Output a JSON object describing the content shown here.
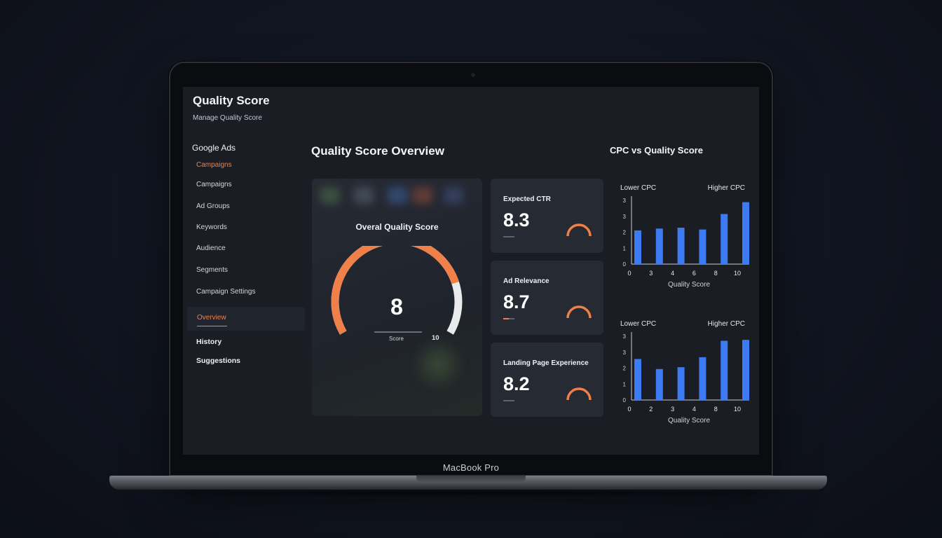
{
  "device": {
    "label": "MacBook Pro"
  },
  "app": {
    "title": "Quality Score",
    "subtitle": "Manage Quality Score"
  },
  "sidebar": {
    "section": "Google Ads",
    "items": [
      {
        "label": "Campaigns",
        "state": "active"
      },
      {
        "label": "Campaigns"
      },
      {
        "label": "Ad Groups"
      },
      {
        "label": "Keywords"
      },
      {
        "label": "Audience"
      },
      {
        "label": "Segments"
      },
      {
        "label": "Campaign Settings"
      }
    ],
    "overview": "Overview",
    "history": "History",
    "suggestions": "Suggestions"
  },
  "overview": {
    "title": "Quality Score Overview",
    "gauge": {
      "label": "Overal Quality Score",
      "value": "8",
      "score_label": "Score",
      "max": "10",
      "fraction": 0.8
    }
  },
  "metrics": [
    {
      "label": "Expected CTR",
      "value": "8.3"
    },
    {
      "label": "Ad Relevance",
      "value": "8.7"
    },
    {
      "label": "Landing Page Experience",
      "value": "8.2"
    }
  ],
  "colors": {
    "accent": "#f0804a",
    "bar": "#3d7bf2",
    "gauge_track": "#e9eaec"
  },
  "cpc_section": {
    "title": "CPC vs Quality Score"
  },
  "chart_data": [
    {
      "type": "bar",
      "title": "",
      "annotations": [
        "Lower CPC",
        "Higher CPC"
      ],
      "categories": [
        "0",
        "3",
        "4",
        "6",
        "8",
        "10"
      ],
      "values": [
        1.85,
        1.95,
        2.0,
        1.9,
        2.75,
        3.4
      ],
      "xlabel": "Quality Score",
      "ylabel": "",
      "yticks": [
        "0",
        "1",
        "2",
        "3",
        "3"
      ],
      "ylim": [
        0,
        3.5
      ],
      "grid": false
    },
    {
      "type": "bar",
      "title": "",
      "annotations": [
        "Lower CPC",
        "Higher CPC"
      ],
      "categories": [
        "0",
        "2",
        "3",
        "4",
        "8",
        "10"
      ],
      "values": [
        2.25,
        1.7,
        1.8,
        2.35,
        3.25,
        3.3
      ],
      "xlabel": "Quality Score",
      "ylabel": "",
      "yticks": [
        "0",
        "1",
        "2",
        "3",
        "3"
      ],
      "ylim": [
        0,
        3.5
      ],
      "grid": false
    }
  ]
}
